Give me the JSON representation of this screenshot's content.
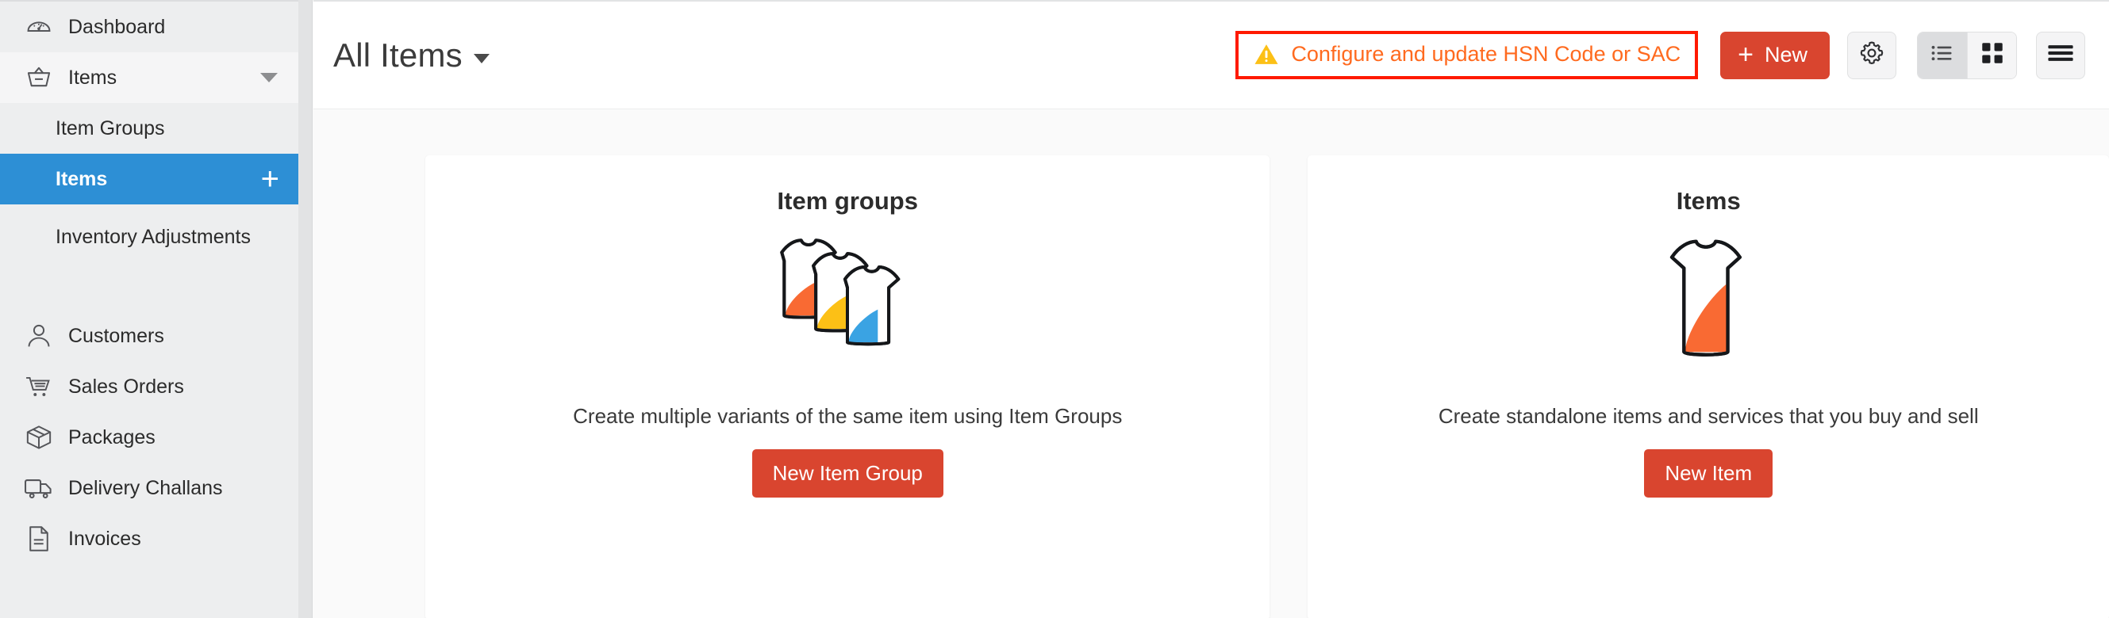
{
  "sidebar": {
    "items": [
      {
        "label": "Dashboard",
        "icon": "dashboard-gauge-icon"
      },
      {
        "label": "Items",
        "icon": "basket-icon",
        "caret": "chevron-down-icon"
      }
    ],
    "sub_items": [
      {
        "label": "Item Groups"
      },
      {
        "label": "Items",
        "selected": true,
        "action_icon": "plus-icon"
      },
      {
        "label": "Inventory Adjustments"
      }
    ],
    "lower_items": [
      {
        "label": "Customers",
        "icon": "person-icon"
      },
      {
        "label": "Sales Orders",
        "icon": "shopping-cart-icon"
      },
      {
        "label": "Packages",
        "icon": "box-icon"
      },
      {
        "label": "Delivery Challans",
        "icon": "truck-icon"
      },
      {
        "label": "Invoices",
        "icon": "document-icon"
      }
    ]
  },
  "topbar": {
    "title": "All Items",
    "title_caret": "chevron-down-icon",
    "hsn_banner": {
      "icon": "warning-triangle-icon",
      "text": "Configure and update HSN Code or SAC",
      "border_color": "#ff1a00",
      "text_color": "#ff6a1f"
    },
    "new_button": {
      "label": "New",
      "icon": "plus-icon",
      "color": "#d9452f"
    },
    "settings_button": {
      "icon": "gear-icon"
    },
    "view_toggle": [
      {
        "icon": "list-view-icon",
        "active": true
      },
      {
        "icon": "grid-view-icon",
        "active": false
      }
    ],
    "menu_button": {
      "icon": "hamburger-menu-icon"
    }
  },
  "cards": [
    {
      "title": "Item groups",
      "art": "three-tshirts-icon",
      "description": "Create multiple variants of the same item using Item Groups",
      "cta": "New Item Group"
    },
    {
      "title": "Items",
      "art": "single-tshirt-icon",
      "description": "Create standalone items and services that you buy and sell",
      "cta": "New Item"
    }
  ],
  "colors": {
    "accent_red": "#d9452f",
    "selected_blue": "#2d8fd5",
    "warning_orange": "#ff6a1f",
    "warning_border": "#ff1a00",
    "tshirt_orange": "#f96a33",
    "tshirt_yellow": "#fcc016",
    "tshirt_blue": "#3aa3e3"
  }
}
